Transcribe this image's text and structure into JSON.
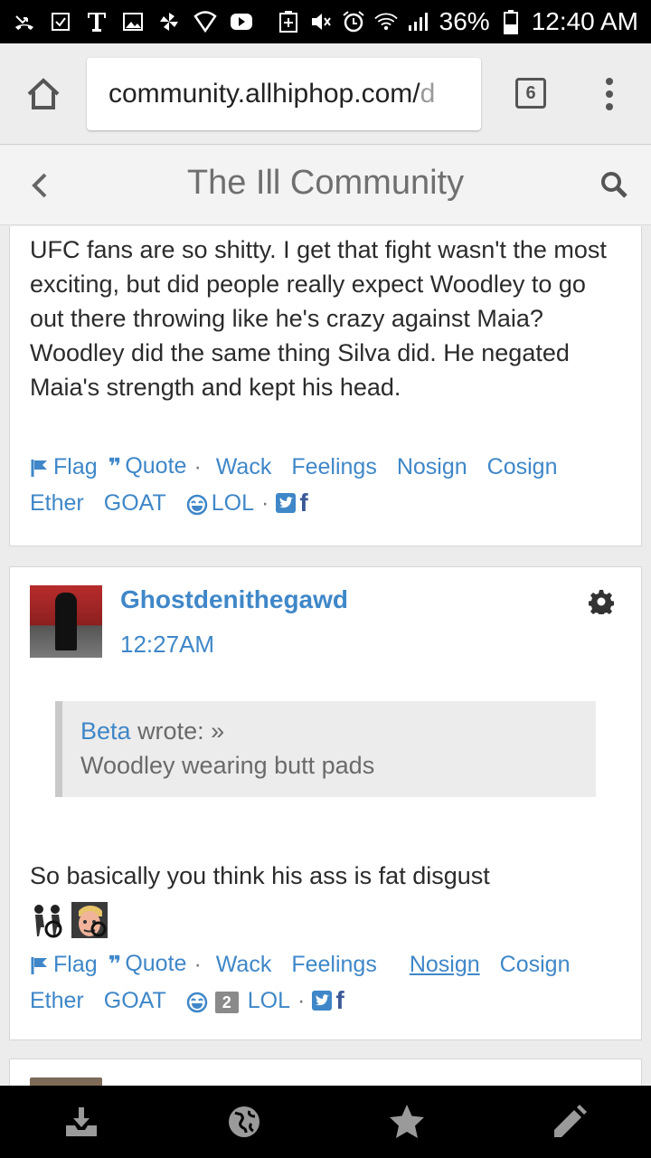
{
  "status_bar": {
    "battery": "36%",
    "time": "12:40 AM"
  },
  "browser": {
    "url_main": "community.allhiphop.com/",
    "url_fade": "d",
    "tab_count": "6"
  },
  "site": {
    "title": "The Ill Community"
  },
  "post1": {
    "body": "UFC fans are so shitty. I get that fight wasn't the most exciting, but did people really expect Woodley to go out there throwing like he's crazy against Maia? Woodley did the same thing Silva did. He negated Maia's strength and kept his head.",
    "reactions": {
      "flag": "Flag",
      "quote": "Quote",
      "wack": "Wack",
      "feelings": "Feelings",
      "nosign": "Nosign",
      "cosign": "Cosign",
      "ether": "Ether",
      "goat": "GOAT",
      "lol": "LOL",
      "sep": "·"
    }
  },
  "post2": {
    "username": "Ghostdenithegawd",
    "time": "12:27AM",
    "quote_author": "Beta",
    "quote_wrote": "wrote: »",
    "quote_text": "Woodley wearing butt pads",
    "body": "So basically you think his ass is fat disgust",
    "reactions": {
      "flag": "Flag",
      "quote": "Quote",
      "wack": "Wack",
      "feelings": "Feelings",
      "nosign": "Nosign",
      "cosign": "Cosign",
      "ether": "Ether",
      "goat": "GOAT",
      "lol_count": "2",
      "lol": "LOL",
      "sep": "·"
    }
  },
  "colors": {
    "link": "#3f87c8",
    "status_bar": "#000000",
    "bottom_nav": "#000000"
  },
  "icons": {
    "bottom_nav": [
      "inbox-download-icon",
      "globe-icon",
      "star-icon",
      "pencil-icon"
    ]
  }
}
